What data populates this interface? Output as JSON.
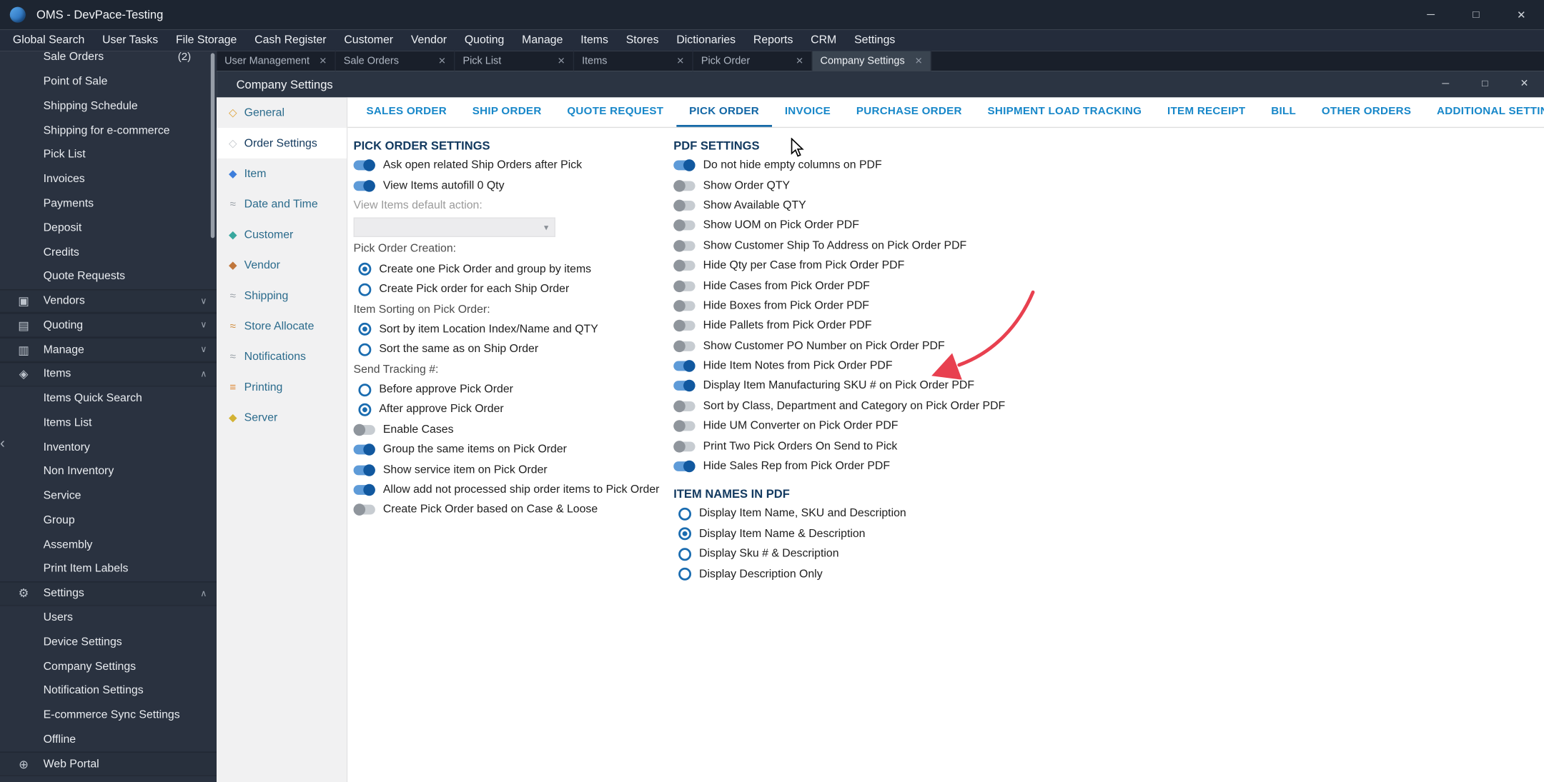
{
  "titlebar": {
    "title": "OMS - DevPace-Testing",
    "minimize": "─",
    "maximize": "□",
    "close": "✕"
  },
  "menubar": {
    "items": [
      "Global Search",
      "User Tasks",
      "File Storage",
      "Cash Register",
      "Customer",
      "Vendor",
      "Quoting",
      "Manage",
      "Items",
      "Stores",
      "Dictionaries",
      "Reports",
      "CRM",
      "Settings"
    ]
  },
  "doc_tabs": [
    {
      "label": "User Management",
      "close": "✕"
    },
    {
      "label": "Sale Orders",
      "close": "✕"
    },
    {
      "label": "Pick List",
      "close": "✕"
    },
    {
      "label": "Items",
      "close": "✕"
    },
    {
      "label": "Pick Order",
      "close": "✕"
    },
    {
      "label": "Company Settings",
      "close": "✕",
      "active": "true"
    }
  ],
  "sidebar": {
    "collapse_glyph": "‹",
    "items": [
      {
        "kind": "plain",
        "label": "Sale Orders",
        "badge": "(2)"
      },
      {
        "kind": "plain",
        "label": "Point of Sale"
      },
      {
        "kind": "plain",
        "label": "Shipping Schedule"
      },
      {
        "kind": "plain",
        "label": "Shipping for e-commerce"
      },
      {
        "kind": "plain",
        "label": "Pick List"
      },
      {
        "kind": "plain",
        "label": "Invoices"
      },
      {
        "kind": "plain",
        "label": "Payments"
      },
      {
        "kind": "plain",
        "label": "Deposit"
      },
      {
        "kind": "plain",
        "label": "Credits"
      },
      {
        "kind": "plain",
        "label": "Quote Requests"
      },
      {
        "kind": "section",
        "label": "Vendors",
        "icon": "▣",
        "chevron": "∨"
      },
      {
        "kind": "section",
        "label": "Quoting",
        "icon": "▤",
        "chevron": "∨"
      },
      {
        "kind": "section",
        "label": "Manage",
        "icon": "▥",
        "chevron": "∨"
      },
      {
        "kind": "section",
        "label": "Items",
        "icon": "◈",
        "chevron": "∧"
      },
      {
        "kind": "sub",
        "label": "Items Quick Search"
      },
      {
        "kind": "sub",
        "label": "Items List"
      },
      {
        "kind": "sub",
        "label": "Inventory"
      },
      {
        "kind": "sub",
        "label": "Non Inventory"
      },
      {
        "kind": "sub",
        "label": "Service"
      },
      {
        "kind": "sub",
        "label": "Group"
      },
      {
        "kind": "sub",
        "label": "Assembly"
      },
      {
        "kind": "sub",
        "label": "Print Item Labels"
      },
      {
        "kind": "section",
        "label": "Settings",
        "icon": "⚙",
        "chevron": "∧"
      },
      {
        "kind": "sub",
        "label": "Users"
      },
      {
        "kind": "sub",
        "label": "Device Settings"
      },
      {
        "kind": "sub",
        "label": "Company Settings"
      },
      {
        "kind": "sub",
        "label": "Notification Settings"
      },
      {
        "kind": "sub",
        "label": "E-commerce Sync Settings"
      },
      {
        "kind": "sub",
        "label": "Offline"
      },
      {
        "kind": "section",
        "label": "Web Portal",
        "icon": "⊕"
      }
    ]
  },
  "panel": {
    "titlebar": {
      "title": "Company Settings",
      "minimize": "─",
      "maximize": "□",
      "close": "✕"
    },
    "nav": [
      {
        "label": "General",
        "glyph": "◇",
        "color": "#dfa43c"
      },
      {
        "label": "Order Settings",
        "glyph": "◇",
        "color": "#c4c8cc",
        "active": "true"
      },
      {
        "label": "Item",
        "glyph": "◆",
        "color": "#3d7edb"
      },
      {
        "label": "Date and Time",
        "glyph": "≈",
        "color": "#9aa1a8"
      },
      {
        "label": "Customer",
        "glyph": "◆",
        "color": "#38a79e"
      },
      {
        "label": "Vendor",
        "glyph": "◆",
        "color": "#c0763c"
      },
      {
        "label": "Shipping",
        "glyph": "≈",
        "color": "#9aa1a8"
      },
      {
        "label": "Store Allocate",
        "glyph": "≈",
        "color": "#d08d3f"
      },
      {
        "label": "Notifications",
        "glyph": "≈",
        "color": "#9aa1a8"
      },
      {
        "label": "Printing",
        "glyph": "≡",
        "color": "#dd8a3a"
      },
      {
        "label": "Server",
        "glyph": "◆",
        "color": "#d3b234"
      }
    ]
  },
  "content_tabs": [
    {
      "label": "SALES ORDER"
    },
    {
      "label": "SHIP ORDER"
    },
    {
      "label": "QUOTE REQUEST"
    },
    {
      "label": "PICK ORDER",
      "active": "true"
    },
    {
      "label": "INVOICE"
    },
    {
      "label": "PURCHASE ORDER"
    },
    {
      "label": "SHIPMENT LOAD TRACKING"
    },
    {
      "label": "ITEM RECEIPT"
    },
    {
      "label": "BILL"
    },
    {
      "label": "OTHER ORDERS"
    },
    {
      "label": "ADDITIONAL SETTINGS"
    }
  ],
  "pick_order": {
    "header": "PICK ORDER SETTINGS",
    "rows": [
      {
        "type": "toggle",
        "state": "on",
        "label": "Ask open related Ship Orders after Pick"
      },
      {
        "type": "toggle",
        "state": "on",
        "label": "View Items autofill 0 Qty"
      },
      {
        "type": "glabel",
        "label": "View Items default action:"
      },
      {
        "type": "select",
        "label": "",
        "chevron": "▾"
      },
      {
        "type": "label",
        "label": "Pick Order Creation:"
      },
      {
        "type": "radio",
        "state": "selected",
        "label": "Create one Pick Order and group by items"
      },
      {
        "type": "radio",
        "state": "unselected",
        "label": "Create Pick order for each Ship Order"
      },
      {
        "type": "label",
        "label": "Item Sorting on Pick Order:"
      },
      {
        "type": "radio",
        "state": "selected",
        "label": "Sort by item Location Index/Name and QTY"
      },
      {
        "type": "radio",
        "state": "unselected",
        "label": "Sort the same as on Ship Order"
      },
      {
        "type": "label",
        "label": "Send Tracking #:"
      },
      {
        "type": "radio",
        "state": "unselected",
        "label": "Before approve Pick Order"
      },
      {
        "type": "radio",
        "state": "selected",
        "label": "After approve Pick Order"
      },
      {
        "type": "toggle",
        "state": "off",
        "label": "Enable Cases"
      },
      {
        "type": "toggle",
        "state": "on",
        "label": "Group the same items on Pick Order"
      },
      {
        "type": "toggle",
        "state": "on",
        "label": "Show service item on Pick Order"
      },
      {
        "type": "toggle",
        "state": "on",
        "label": "Allow add not processed ship order items to Pick Order"
      },
      {
        "type": "toggle",
        "state": "off",
        "label": "Create Pick Order based on Case & Loose"
      }
    ]
  },
  "pdf": {
    "header": "PDF SETTINGS",
    "rows": [
      {
        "type": "toggle",
        "state": "on",
        "label": "Do not hide empty columns on PDF"
      },
      {
        "type": "toggle",
        "state": "off",
        "label": "Show Order QTY"
      },
      {
        "type": "toggle",
        "state": "off",
        "label": "Show Available QTY"
      },
      {
        "type": "toggle",
        "state": "off",
        "label": "Show UOM on Pick Order PDF"
      },
      {
        "type": "toggle",
        "state": "off",
        "label": "Show Customer Ship To Address on Pick Order PDF"
      },
      {
        "type": "toggle",
        "state": "off",
        "label": "Hide Qty per Case from Pick Order PDF"
      },
      {
        "type": "toggle",
        "state": "off",
        "label": "Hide Cases from Pick Order PDF"
      },
      {
        "type": "toggle",
        "state": "off",
        "label": "Hide Boxes from Pick Order PDF"
      },
      {
        "type": "toggle",
        "state": "off",
        "label": "Hide Pallets from Pick Order PDF"
      },
      {
        "type": "toggle",
        "state": "off",
        "label": "Show Customer PO Number on Pick Order PDF"
      },
      {
        "type": "toggle",
        "state": "on",
        "label": "Hide Item Notes from Pick Order PDF"
      },
      {
        "type": "toggle",
        "state": "on",
        "label": "Display Item Manufacturing SKU # on Pick Order PDF"
      },
      {
        "type": "toggle",
        "state": "off",
        "label": "Sort by Class, Department and Category on Pick Order PDF"
      },
      {
        "type": "toggle",
        "state": "off",
        "label": "Hide UM Converter on Pick Order PDF"
      },
      {
        "type": "toggle",
        "state": "off",
        "label": "Print Two Pick Orders On Send to Pick"
      },
      {
        "type": "toggle",
        "state": "on",
        "label": "Hide Sales Rep from Pick Order PDF"
      }
    ]
  },
  "item_names": {
    "header": "ITEM NAMES IN PDF",
    "rows": [
      {
        "type": "radio",
        "state": "unselected",
        "label": "Display Item Name, SKU and Description"
      },
      {
        "type": "radio",
        "state": "selected",
        "label": "Display Item Name & Description"
      },
      {
        "type": "radio",
        "state": "unselected",
        "label": "Display Sku # & Description"
      },
      {
        "type": "radio",
        "state": "unselected",
        "label": "Display Description Only"
      }
    ]
  },
  "annotation": {
    "arrow_color": "#e8404f"
  },
  "colors": {
    "accent_blue": "#1787c9",
    "toggle_on": "#11589f",
    "header_navy": "#133a60",
    "nav_text": "#2b6b8c"
  }
}
